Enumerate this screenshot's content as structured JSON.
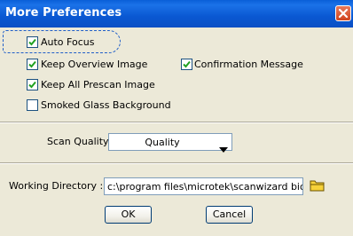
{
  "window": {
    "title": "More Preferences",
    "close_icon": "close-x-icon"
  },
  "options": {
    "auto_focus": {
      "label": "Auto Focus",
      "checked": true
    },
    "keep_overview": {
      "label": "Keep Overview Image",
      "checked": true
    },
    "confirmation": {
      "label": "Confirmation Message",
      "checked": true
    },
    "keep_prescan": {
      "label": "Keep All Prescan Image",
      "checked": true
    },
    "smoked_glass": {
      "label": "Smoked Glass Background",
      "checked": false
    }
  },
  "scan_quality": {
    "label": "Scan Quality :",
    "selected": "Quality"
  },
  "working_directory": {
    "label": "Working Directory :",
    "value": "c:\\program files\\microtek\\scanwizard bio\\data\\",
    "browse_icon": "folder-icon"
  },
  "buttons": {
    "ok": "OK",
    "cancel": "Cancel"
  },
  "colors": {
    "title_bar": "#0a58d2",
    "close_button": "#d0441f",
    "dialog_background": "#ece9d8",
    "checkmark": "#21a121"
  }
}
